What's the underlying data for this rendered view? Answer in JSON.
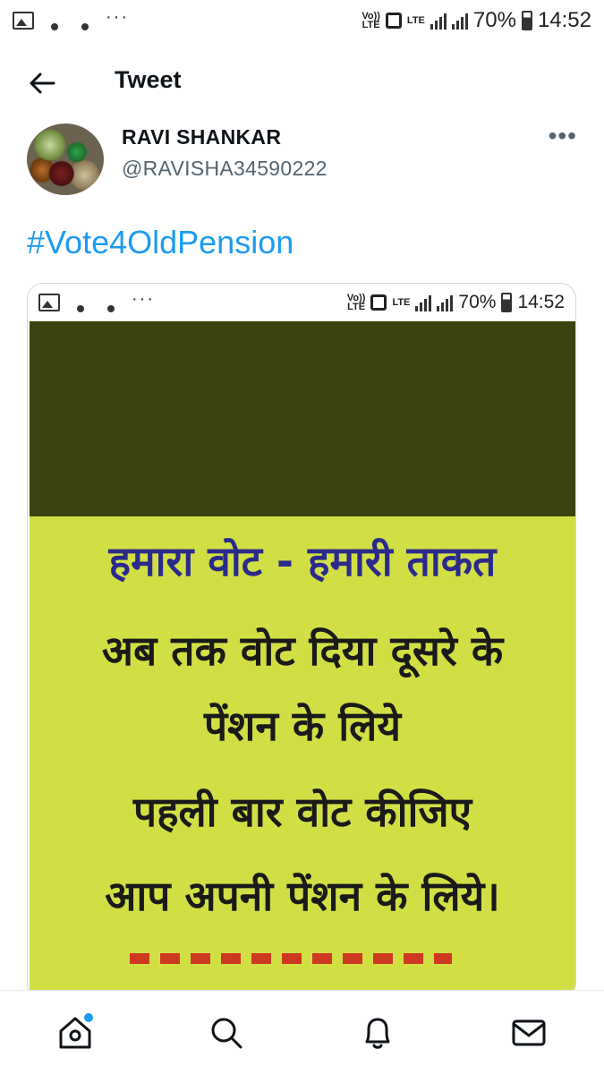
{
  "status_bar": {
    "volte": "Vo))\nLTE",
    "lte": "LTE",
    "battery": "70%",
    "time": "14:52"
  },
  "header": {
    "title": "Tweet"
  },
  "tweet": {
    "author_name": "RAVI SHANKAR",
    "author_handle": "@RAVISHA34590222",
    "more": "•••",
    "text": "#Vote4OldPension",
    "media": {
      "status_bar": {
        "battery": "70%",
        "time": "14:52"
      },
      "colors": {
        "dark_block": "#3a430f",
        "poster_bg": "#d1df45",
        "heading": "#2b2a8c"
      },
      "lines": [
        "हमारा वोट - हमारी ताकत",
        "अब तक वोट दिया दूसरे के",
        "पेंशन के लिये",
        "पहली बार वोट कीजिए",
        "आप अपनी पेंशन के लिये।"
      ]
    }
  },
  "nav": {
    "items": [
      "home-icon",
      "search-icon",
      "bell-icon",
      "mail-icon"
    ],
    "accent": "#1d9bf0"
  }
}
